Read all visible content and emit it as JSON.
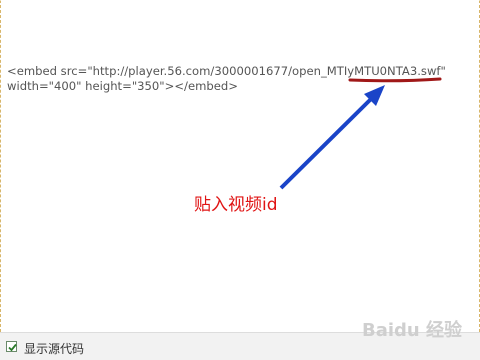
{
  "editor": {
    "code_line_1": "<embed src=\"http://player.56.com/3000001677/open_MTIyMTU0NTA3.swf\"",
    "code_line_2": "width=\"400\" height=\"350\"></embed>"
  },
  "annotation": {
    "text": "贴入视频id",
    "color": "#e01414",
    "arrow_color": "#1a44c8",
    "underline_color": "#a01818",
    "icon": "arrow-icon"
  },
  "footer": {
    "checkbox_checked": true,
    "checkbox_label": "显示源代码"
  },
  "watermark": {
    "text": "Baidu 经验"
  }
}
